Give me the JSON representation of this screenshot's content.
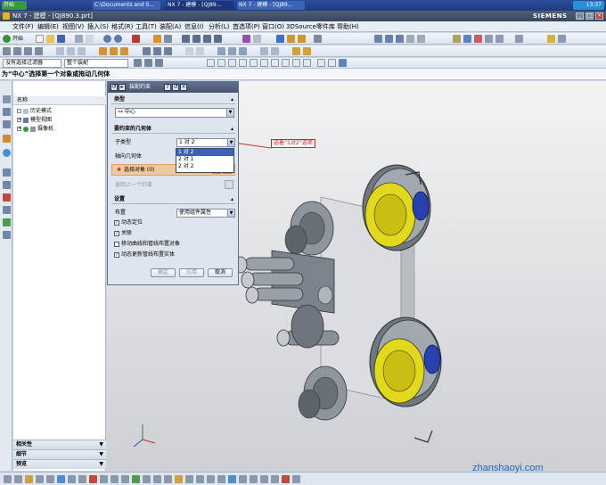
{
  "taskbar": {
    "start_label": "开始",
    "tasks": [
      "C:\\Documents and S...",
      "NX 7 - 建模 - [QJ89...",
      "NX 7 - 建模 - [QJ89..."
    ],
    "clock": "13:37"
  },
  "window": {
    "title": "NX 7 - 建模 - [QJ890.3.prt]",
    "brand": "SIEMENS"
  },
  "menu": [
    "文件(F)",
    "编辑(E)",
    "视图(V)",
    "插入(S)",
    "格式(R)",
    "工具(T)",
    "装配(A)",
    "信息(I)",
    "分析(L)",
    "首选项(P)",
    "窗口(O)",
    "3DSource零件库",
    "帮助(H)"
  ],
  "toolbar": {
    "start_label": "开始",
    "filter_value": "没有选择过滤器",
    "assembly_scope": "整个装配"
  },
  "cue_line": "为“中心”选择第一个对象或拖动几何体",
  "navigator": {
    "col_header": "名称",
    "items": [
      "历史模式",
      "模型视图",
      "摄像机"
    ],
    "sections": [
      "相关性",
      "细节",
      "预览"
    ]
  },
  "dialog": {
    "title": "装配约束",
    "type_section": "类型",
    "type_value": "中心",
    "geometry_section": "要约束的几何体",
    "subtype_label": "子类型",
    "subtype_value": "1 对 2",
    "subtype_options": [
      "1 对 2",
      "2 对 1",
      "2 对 2"
    ],
    "axial_label": "轴向几何体",
    "select_object_label": "选择对象 (0)",
    "reverse_label": "返回上一个约束",
    "settings_section": "设置",
    "arrangement_label": "布置",
    "arrangement_value": "使用组件属性",
    "checks": [
      {
        "label": "动态定位",
        "checked": true
      },
      {
        "label": "关联",
        "checked": true
      },
      {
        "label": "移动曲线和管线布置对象",
        "checked": false
      },
      {
        "label": "动态更新管线布置实体",
        "checked": true
      }
    ],
    "buttons": [
      "确定",
      "应用",
      "取消"
    ]
  },
  "annotation": {
    "callout": "选着“1对2”选项"
  },
  "watermark": "zhanshaoyi.com",
  "colors": {
    "title_bar": "#46556f",
    "selection": "#3d63b8",
    "callout": "#c0282d",
    "gear_yellow": "#e2d81c",
    "gear_blue": "#2741b0",
    "part_gray": "#8f959c"
  }
}
